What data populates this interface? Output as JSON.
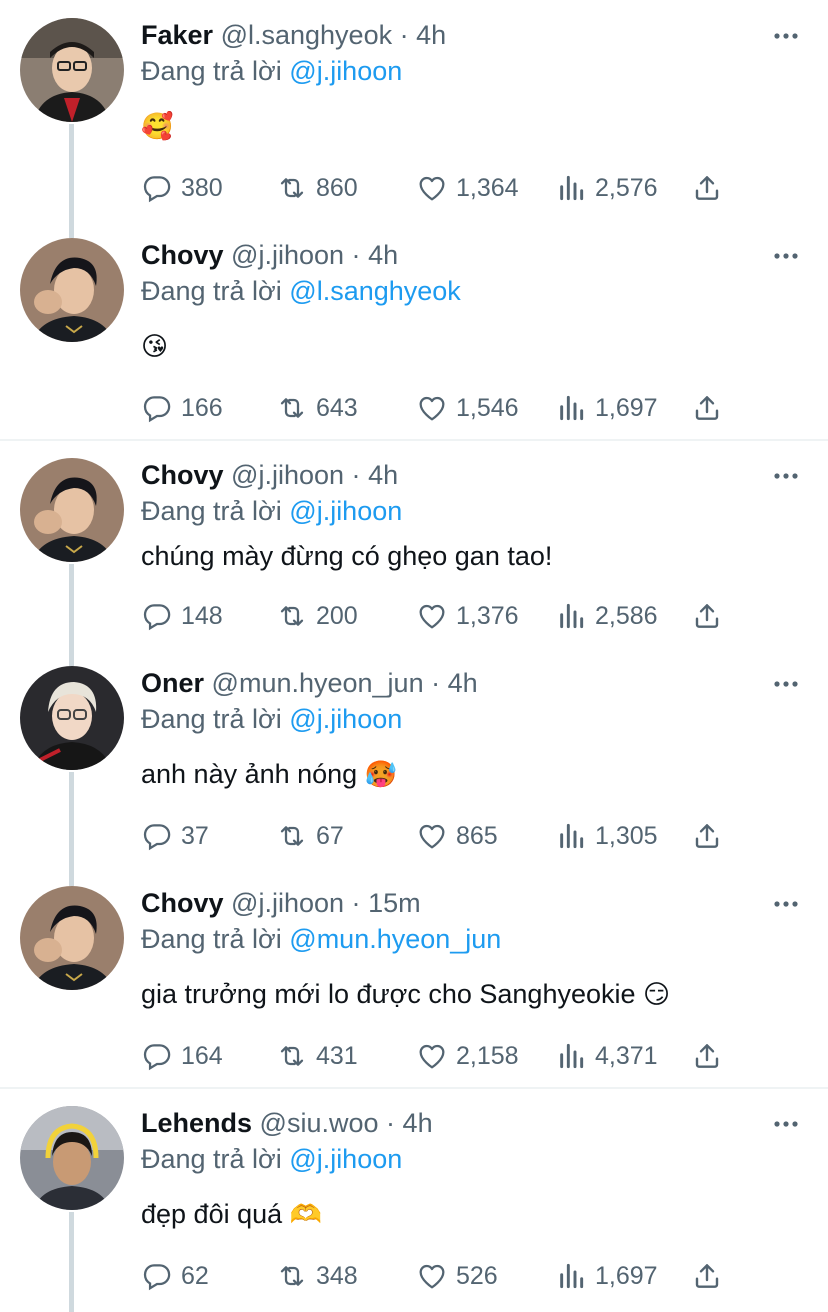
{
  "labels": {
    "replying_prefix": "Đang trả lời"
  },
  "colors": {
    "accent": "#1d9bf0",
    "secondary_text": "#536471",
    "thread_line": "#cfd9de"
  },
  "icons": [
    "reply-icon",
    "retweet-icon",
    "like-icon",
    "views-icon",
    "share-icon",
    "more-icon"
  ],
  "tweets": [
    {
      "name": "Faker",
      "handle": "@l.sanghyeok",
      "time": "4h",
      "replying_to": "@j.jihoon",
      "text": "",
      "emoji": "🥰",
      "stats": {
        "replies": "380",
        "retweets": "860",
        "likes": "1,364",
        "views": "2,576"
      }
    },
    {
      "name": "Chovy",
      "handle": "@j.jihoon",
      "time": "4h",
      "replying_to": "@l.sanghyeok",
      "text": "",
      "emoji": "😘",
      "stats": {
        "replies": "166",
        "retweets": "643",
        "likes": "1,546",
        "views": "1,697"
      }
    },
    {
      "name": "Chovy",
      "handle": "@j.jihoon",
      "time": "4h",
      "replying_to": "@j.jihoon",
      "text": "chúng mày đừng có ghẹo gan tao!",
      "emoji": "",
      "stats": {
        "replies": "148",
        "retweets": "200",
        "likes": "1,376",
        "views": "2,586"
      }
    },
    {
      "name": "Oner",
      "handle": "@mun.hyeon_jun",
      "time": "4h",
      "replying_to": "@j.jihoon",
      "text": "anh này ảnh nóng",
      "emoji": "🥵",
      "stats": {
        "replies": "37",
        "retweets": "67",
        "likes": "865",
        "views": "1,305"
      }
    },
    {
      "name": "Chovy",
      "handle": "@j.jihoon",
      "time": "15m",
      "replying_to": "@mun.hyeon_jun",
      "text": "gia trưởng mới lo được cho Sanghyeokie",
      "emoji": "😏",
      "stats": {
        "replies": "164",
        "retweets": "431",
        "likes": "2,158",
        "views": "4,371"
      }
    },
    {
      "name": "Lehends",
      "handle": "@siu.woo",
      "time": "4h",
      "replying_to": "@j.jihoon",
      "text": "đẹp đôi quá",
      "emoji": "🫶",
      "stats": {
        "replies": "62",
        "retweets": "348",
        "likes": "526",
        "views": "1,697"
      }
    }
  ]
}
